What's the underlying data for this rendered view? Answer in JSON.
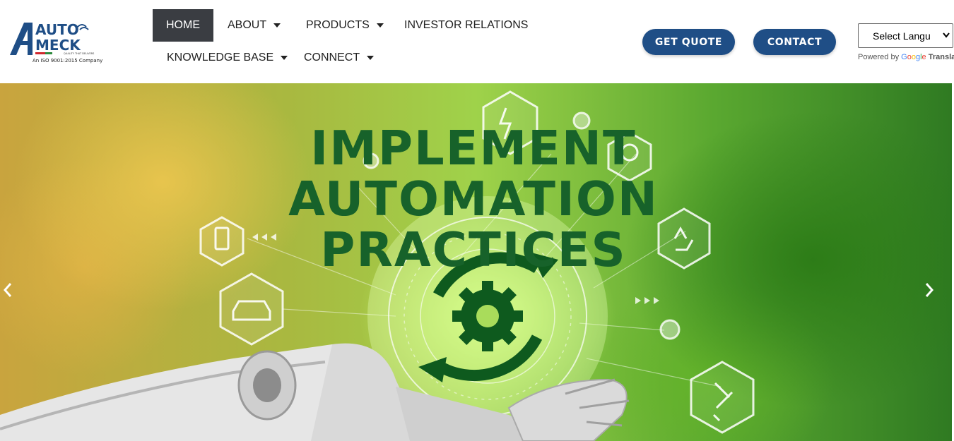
{
  "brand": {
    "logo_top": "AUTO",
    "logo_bottom": "MECK",
    "tagline": "QUALITY THAT DELIVERS",
    "certification": "An ISO 9001:2015 Company",
    "accent_color": "#1f4e86"
  },
  "nav": {
    "home": "HOME",
    "about": "ABOUT",
    "products": "PRODUCTS",
    "investor_relations": "INVESTOR RELATIONS",
    "knowledge_base": "KNOWLEDGE BASE",
    "connect": "CONNECT",
    "active": "HOME"
  },
  "actions": {
    "get_quote": "GET QUOTE",
    "contact": "CONTACT"
  },
  "language": {
    "selected": "Select Langu",
    "powered_by": "Powered by",
    "translate": "Transla"
  },
  "hero": {
    "line1": "IMPLEMENT",
    "line2": "AUTOMATION",
    "line3": "PRACTICES",
    "prev_icon": "chevron-left-icon",
    "next_icon": "chevron-right-icon",
    "title_color": "#17622a"
  }
}
